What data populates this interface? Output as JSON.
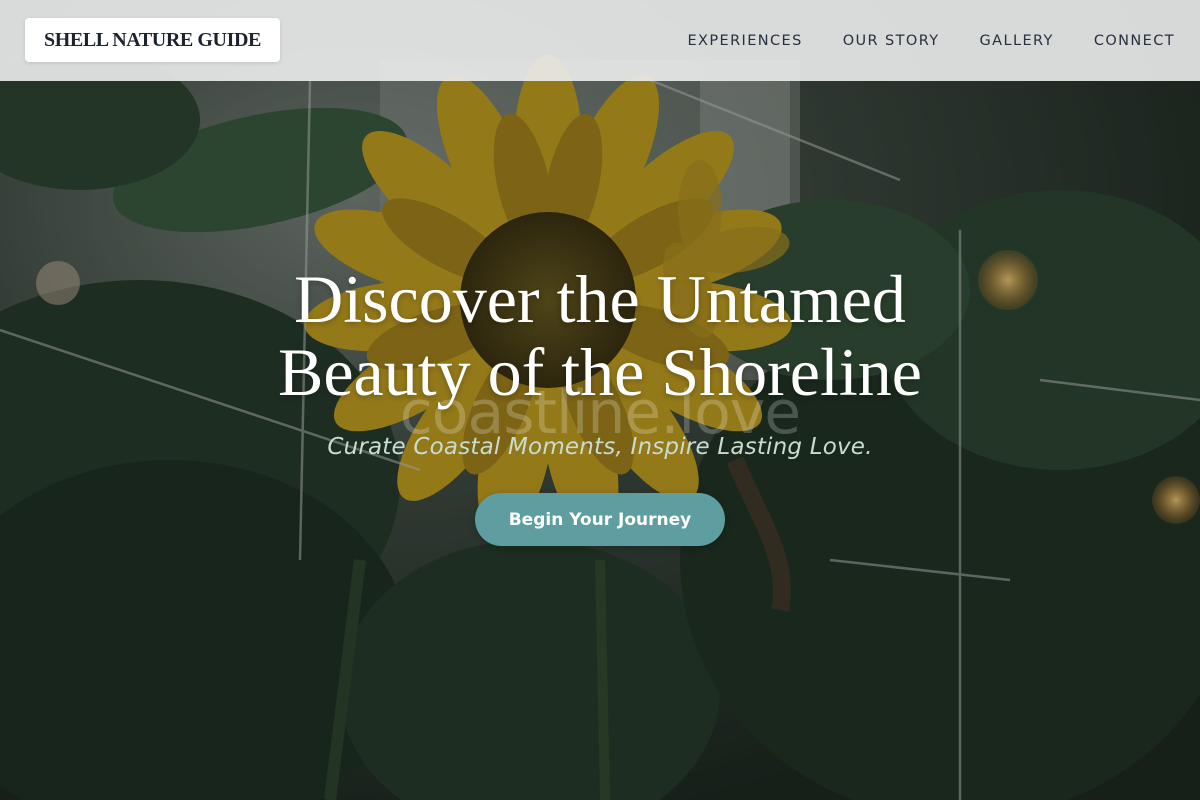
{
  "header": {
    "logo": "SHELL NATURE GUIDE",
    "nav": [
      "EXPERIENCES",
      "OUR STORY",
      "GALLERY",
      "CONNECT"
    ]
  },
  "hero": {
    "background_image": "sunflower-garden-photo",
    "headline_line1": "Discover the Untamed",
    "headline_line2": "Beauty of the Shoreline",
    "watermark": "coastline.love",
    "tagline": "Curate Coastal Moments, Inspire Lasting Love.",
    "cta_label": "Begin Your Journey"
  },
  "colors": {
    "header_bg": "#ecedee",
    "cta_bg": "#5f9ea0",
    "tagline": "#c8ddd0",
    "nav_text": "#263040"
  }
}
